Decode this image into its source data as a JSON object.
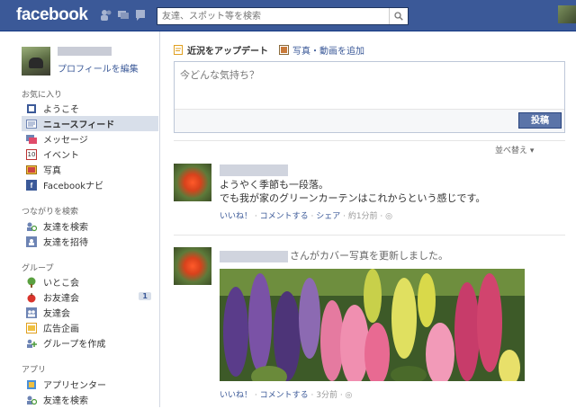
{
  "topbar": {
    "logo": "facebook",
    "search_placeholder": "友達、スポット等を検索"
  },
  "profile": {
    "edit_label": "プロフィールを編集"
  },
  "sidebar": {
    "favorites_title": "お気に入り",
    "favorites": [
      "ようこそ",
      "ニュースフィード",
      "メッセージ",
      "イベント",
      "写真",
      "Facebookナビ"
    ],
    "connect_title": "つながりを検索",
    "connect": [
      "友達を検索",
      "友達を招待"
    ],
    "groups_title": "グループ",
    "groups": [
      "いとこ会",
      "お友達会",
      "友達会",
      "広告企画",
      "グループを作成"
    ],
    "groups_badge": "1",
    "apps_title": "アプリ",
    "apps": [
      "アプリセンター",
      "友達を検索"
    ],
    "event_icon_text": "10"
  },
  "composer": {
    "tab_status": "近況をアップデート",
    "tab_photo": "写真・動画を追加",
    "placeholder": "今どんな気持ち？",
    "post_label": "投稿"
  },
  "feed": {
    "sort_label": "並べ替え",
    "story1": {
      "line1": "ようやく季節も一段落。",
      "line2": "でも我が家のグリーンカーテンはこれからという感じです。",
      "like": "いいね！",
      "comment": "コメントする",
      "share": "シェア",
      "time": "約1分前"
    },
    "story2": {
      "cover_text": "さんがカバー写真を更新しました。",
      "like": "いいね！",
      "comment": "コメントする",
      "time": "3分前"
    }
  },
  "colors": {
    "brand": "#3b5998",
    "selected_bg": "#d8dfea",
    "button": "#5b74a8"
  }
}
